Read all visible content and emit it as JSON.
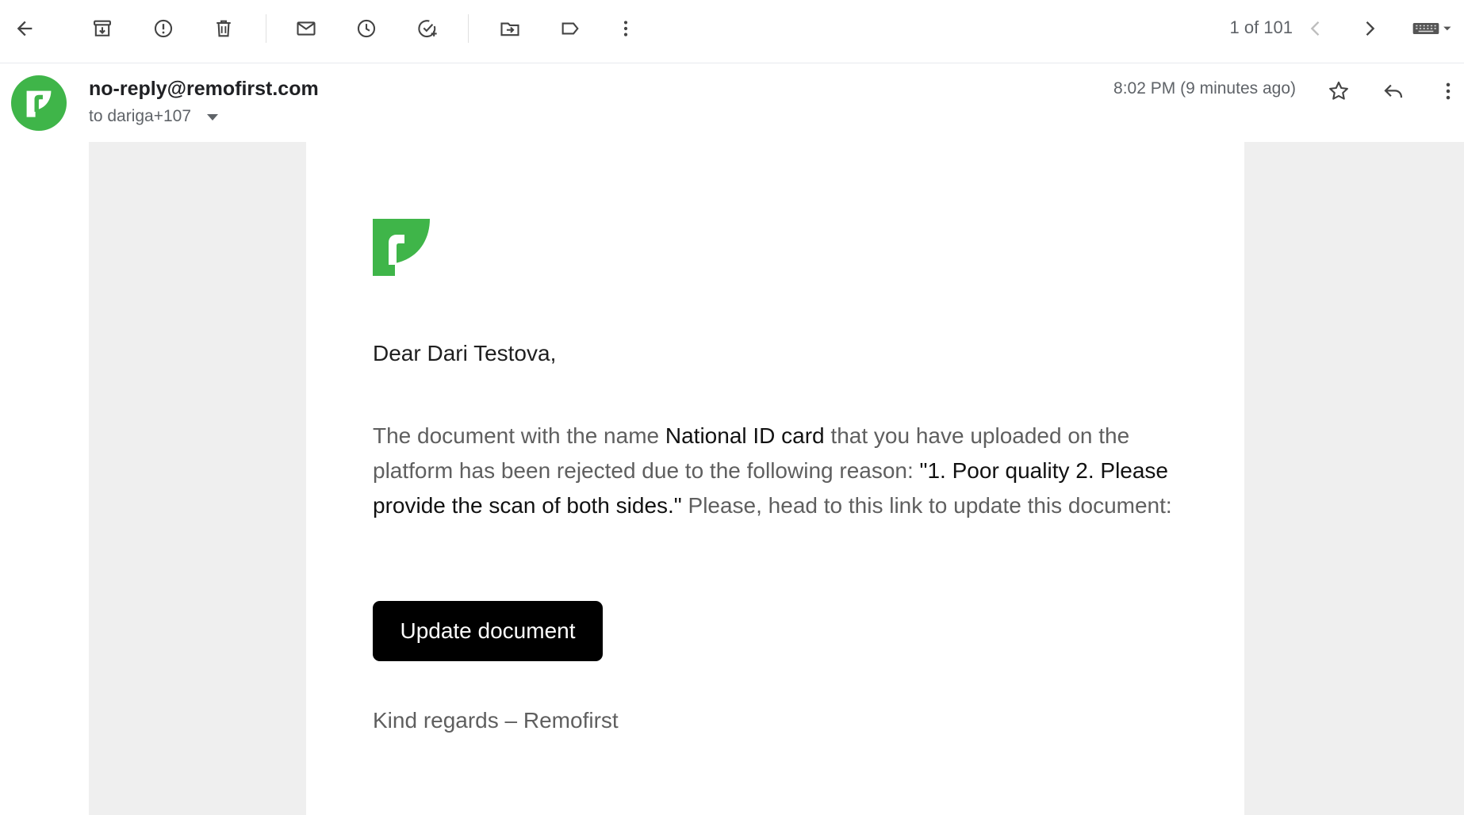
{
  "toolbar": {
    "icons": [
      "back-arrow-icon",
      "archive-icon",
      "report-spam-icon",
      "delete-icon",
      "mark-unread-icon",
      "snooze-icon",
      "add-task-icon",
      "move-to-icon",
      "label-icon",
      "more-vert-icon",
      "chevron-left-icon",
      "chevron-right-icon",
      "keyboard-icon"
    ],
    "counter": "1 of 101"
  },
  "header": {
    "sender": "no-reply@remofirst.com",
    "recipient": "to dariga+107",
    "time": "8:02 PM (9 minutes ago)"
  },
  "email": {
    "greeting": "Dear Dari Testova,",
    "body_part1": "The document with the name ",
    "doc_name": "National ID card",
    "body_part2": " that you have uploaded on the platform has been rejected due to the following reason: ",
    "reason": "\"1. Poor quality 2. Please provide the scan of both sides.\"",
    "body_part3": " Please, head to this link to update this document:",
    "button_label": "Update document",
    "signoff": "Kind regards – Remofirst"
  },
  "colors": {
    "brand_green": "#3fb549",
    "button_bg": "#000000",
    "frame_gray": "#efefef"
  }
}
